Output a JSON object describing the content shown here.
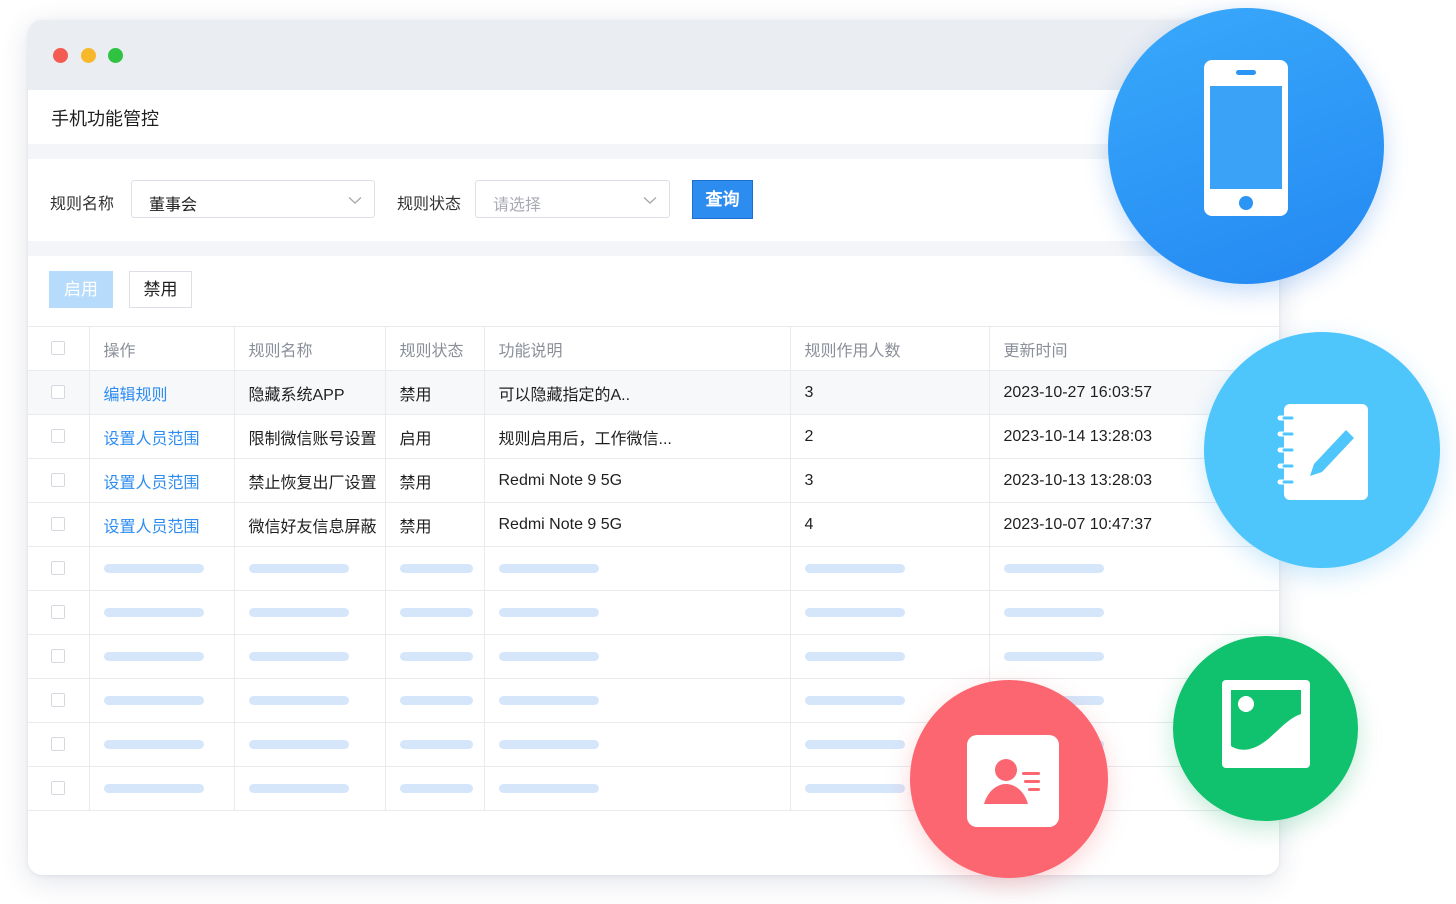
{
  "page_title": "手机功能管控",
  "filters": {
    "rule_name_label": "规则名称",
    "rule_name_value": "董事会",
    "rule_status_label": "规则状态",
    "rule_status_placeholder": "请选择",
    "query_button": "查询"
  },
  "actions": {
    "enable_button": "启用",
    "disable_button": "禁用"
  },
  "table": {
    "columns": [
      "操作",
      "规则名称",
      "规则状态",
      "功能说明",
      "规则作用人数",
      "更新时间"
    ],
    "rows": [
      {
        "action": "编辑规则",
        "name": "隐藏系统APP",
        "status": "禁用",
        "desc": "可以隐藏指定的A..",
        "count": "3",
        "updated": "2023-10-27 16:03:57"
      },
      {
        "action": "设置人员范围",
        "name": "限制微信账号设置",
        "status": "启用",
        "desc": "规则启用后，工作微信...",
        "count": "2",
        "updated": "2023-10-14 13:28:03"
      },
      {
        "action": "设置人员范围",
        "name": "禁止恢复出厂设置",
        "status": "禁用",
        "desc": "Redmi Note 9 5G",
        "count": "3",
        "updated": "2023-10-13 13:28:03"
      },
      {
        "action": "设置人员范围",
        "name": "微信好友信息屏蔽",
        "status": "禁用",
        "desc": "Redmi Note 9 5G",
        "count": "4",
        "updated": "2023-10-07 10:47:37"
      }
    ],
    "placeholder_rows": 6
  },
  "decorations": {
    "icons": [
      "smartphone-icon",
      "notebook-pen-icon",
      "image-icon",
      "contact-card-icon"
    ],
    "colors": {
      "phone": "#2b95f6",
      "note": "#4ec5fb",
      "photo": "#10c16d",
      "contact": "#fb6670",
      "accent": "#2d8cf0"
    }
  }
}
